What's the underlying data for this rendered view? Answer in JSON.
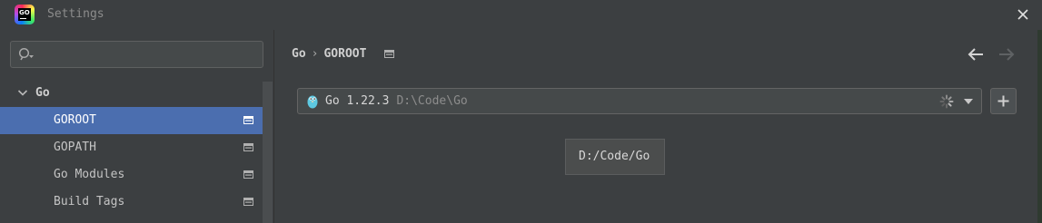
{
  "window": {
    "title": "Settings",
    "app_icon": "goland-logo-icon",
    "logo_text": "GO"
  },
  "search": {
    "placeholder": "",
    "value": "",
    "icon": "search-icon"
  },
  "sidebar": {
    "group": {
      "label": "Go",
      "expanded": true
    },
    "items": [
      {
        "label": "GOROOT",
        "selected": true,
        "icon": "project-scope-icon"
      },
      {
        "label": "GOPATH",
        "selected": false,
        "icon": "project-scope-icon"
      },
      {
        "label": "Go Modules",
        "selected": false,
        "icon": "project-scope-icon"
      },
      {
        "label": "Build Tags",
        "selected": false,
        "icon": "project-scope-icon"
      }
    ]
  },
  "breadcrumb": {
    "parent": "Go",
    "separator": "›",
    "current": "GOROOT"
  },
  "navigation": {
    "back_icon": "arrow-left-icon",
    "forward_icon": "arrow-right-icon",
    "forward_enabled": false
  },
  "sdk": {
    "name": "Go 1.22.3",
    "path": "D:\\Code\\Go",
    "loading": true
  },
  "tooltip": {
    "text": "D:/Code/Go"
  },
  "colors": {
    "background": "#3c3f41",
    "selection": "#4b6eaf",
    "input_background": "#45494a",
    "gopher": "#5dc9e2"
  }
}
